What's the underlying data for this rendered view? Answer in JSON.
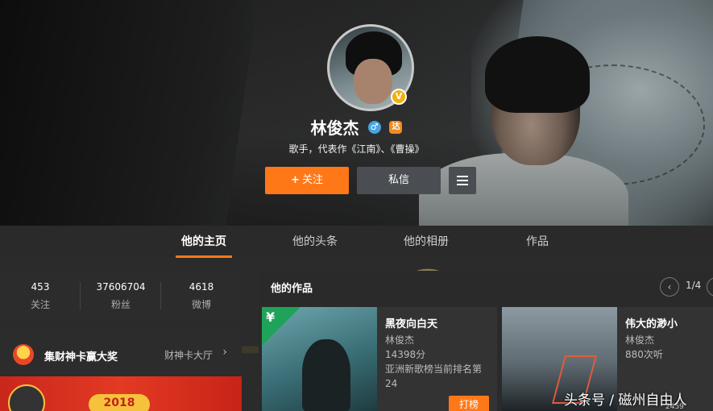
{
  "profile": {
    "name": "林俊杰",
    "verified_badge": "V",
    "gender_icon": "♂",
    "level_icon": "达",
    "bio": "歌手，代表作《江南》、《曹操》",
    "follow_plus": "+",
    "follow_label": "关注",
    "message_label": "私信"
  },
  "nav": {
    "tabs": [
      {
        "label": "他的主页",
        "active": true
      },
      {
        "label": "他的头条",
        "active": false
      },
      {
        "label": "他的相册",
        "active": false
      },
      {
        "label": "作品",
        "active": false
      }
    ]
  },
  "stats": [
    {
      "value": "453",
      "label": "关注"
    },
    {
      "value": "37606704",
      "label": "粉丝"
    },
    {
      "value": "4618",
      "label": "微博"
    }
  ],
  "promo": {
    "title": "集财神卡赢大奖",
    "link": "财神卡大厅",
    "arrow": "›",
    "year": "2018"
  },
  "works": {
    "title": "他的作品",
    "prev": "‹",
    "page": "1/4",
    "items": [
      {
        "corner": "¥",
        "song": "黑夜向白天",
        "artist": "林俊杰",
        "plays": "14398分",
        "rank": "亚洲新歌榜当前排名第24",
        "action": "打榜"
      },
      {
        "song": "伟大的渺小",
        "artist": "林俊杰",
        "plays": "880次听"
      }
    ]
  },
  "watermark": "头条号 / 磁州自由人",
  "tiny_count": "2459",
  "colors": {
    "accent": "#ff7818",
    "nav_bg": "#2a2a2a",
    "panel_bg": "#2c2c2c",
    "gender_blue": "#4aa3e0",
    "verified_gold": "#f4b00b",
    "paid_green": "#1fa35a"
  }
}
